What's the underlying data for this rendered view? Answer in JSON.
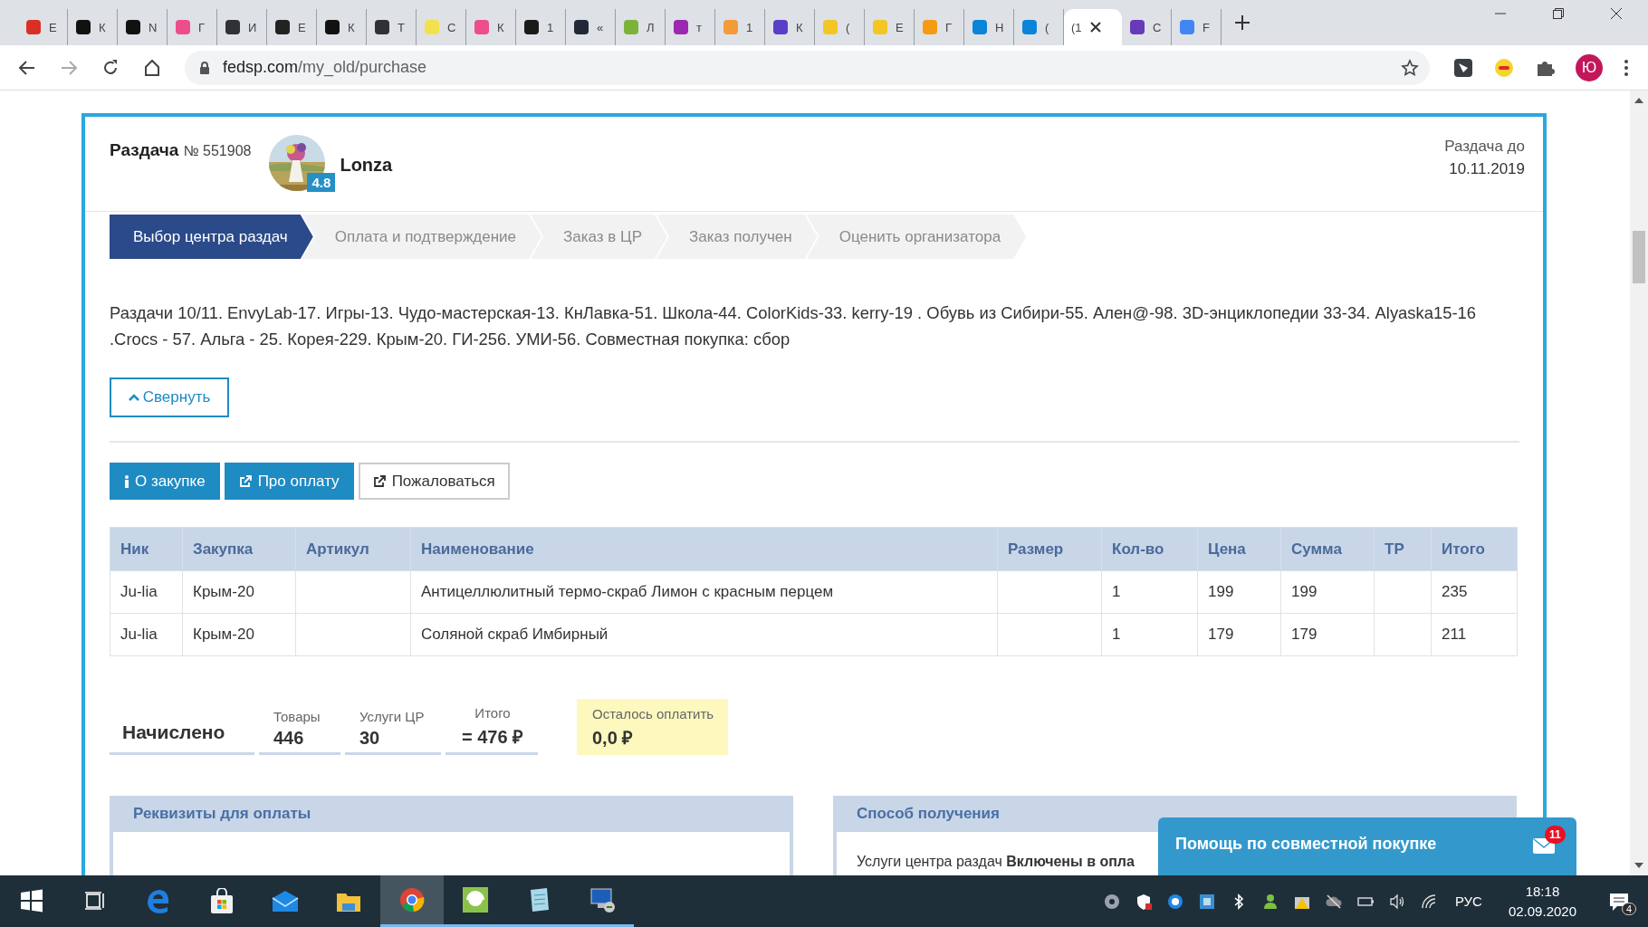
{
  "browser": {
    "tabs": [
      {
        "title": "Е",
        "color": "#d93025",
        "selected": false
      },
      {
        "title": "К",
        "color": "#111111",
        "selected": false
      },
      {
        "title": "N",
        "color": "#111111",
        "selected": false
      },
      {
        "title": "Г",
        "color": "#ee4d8b",
        "selected": false
      },
      {
        "title": "И",
        "color": "#2f3136",
        "selected": false
      },
      {
        "title": "Е",
        "color": "#222222",
        "selected": false
      },
      {
        "title": "К",
        "color": "#111111",
        "selected": false
      },
      {
        "title": "Т",
        "color": "#2f3136",
        "selected": false
      },
      {
        "title": "С",
        "color": "#f4e04d",
        "selected": false
      },
      {
        "title": "К",
        "color": "#ee4d8b",
        "selected": false
      },
      {
        "title": "1",
        "color": "#1a1a1a",
        "selected": false
      },
      {
        "title": "«",
        "color": "#222838",
        "selected": false
      },
      {
        "title": "Л",
        "color": "#7bb33a",
        "selected": false
      },
      {
        "title": "т",
        "color": "#9c27b0",
        "selected": false
      },
      {
        "title": "1",
        "color": "#f29c38",
        "selected": false
      },
      {
        "title": "К",
        "color": "#5a3ec8",
        "selected": false
      },
      {
        "title": "(",
        "color": "#f3c623",
        "selected": false
      },
      {
        "title": "Е",
        "color": "#f3c623",
        "selected": false
      },
      {
        "title": "Г",
        "color": "#f39c12",
        "selected": false
      },
      {
        "title": "Н",
        "color": "#0a84d8",
        "selected": false
      },
      {
        "title": "(",
        "color": "#0a84d8",
        "selected": false
      },
      {
        "title": "(1",
        "selected": true
      },
      {
        "title": "С",
        "color": "#673ab7",
        "selected": false
      },
      {
        "title": "F",
        "color": "#4285f4",
        "selected": false
      }
    ],
    "address": {
      "host": "fedsp.com",
      "path": "/my_old/purchase"
    },
    "profile_initial": "Ю"
  },
  "page": {
    "header": {
      "title": "Раздача",
      "number": "№ 551908",
      "organizer": "Lonza",
      "rating": "4.8",
      "deadline_label": "Раздача до",
      "deadline": "10.11.2019"
    },
    "steps": [
      {
        "label": "Выбор центра раздач",
        "selected": true
      },
      {
        "label": "Оплата и подтверждение",
        "selected": false
      },
      {
        "label": "Заказ в ЦР",
        "selected": false
      },
      {
        "label": "Заказ получен",
        "selected": false
      },
      {
        "label": "Оценить организатора",
        "selected": false
      }
    ],
    "description": "Раздачи 10/11. EnvyLab-17. Игры-13. Чудо-мастерская-13. КнЛавка-51. Школа-44. ColorKids-33. kerry-19 . Обувь из Сибири-55. Ален@-98. 3D-энциклопедии 33-34. Alyaska15-16 .Crocs - 57. Альга - 25. Корея-229. Крым-20. ГИ-256. УМИ-56. Совместная покупка: сбор",
    "collapse_button": "Свернуть",
    "action_buttons": [
      {
        "label": "О закупке",
        "kind": "info",
        "primary": true
      },
      {
        "label": "Про оплату",
        "kind": "link",
        "primary": true
      },
      {
        "label": "Пожаловаться",
        "kind": "link",
        "primary": false
      }
    ],
    "table": {
      "columns": [
        "Ник",
        "Закупка",
        "Артикул",
        "Наименование",
        "Размер",
        "Кол-во",
        "Цена",
        "Сумма",
        "ТР",
        "Итого"
      ],
      "rows": [
        [
          "Ju-lia",
          "Крым-20",
          null,
          "Антицеллюлитный термо-скраб Лимон с красным перцем",
          null,
          "1",
          "199",
          "199",
          null,
          "235"
        ],
        [
          "Ju-lia",
          "Крым-20",
          null,
          "Соляной скраб Имбирный",
          null,
          "1",
          "179",
          "179",
          null,
          "211"
        ]
      ]
    },
    "summary": {
      "title": "Начислено",
      "items": [
        {
          "label": "Товары",
          "value": "446"
        },
        {
          "label": "Услуги ЦР",
          "value": "30"
        },
        {
          "label": "Итого",
          "value": "= 476 ₽"
        }
      ],
      "remaining": {
        "label": "Осталось оплатить",
        "value": "0,0 ₽"
      }
    },
    "panels": [
      {
        "title": "Реквизиты для оплаты"
      },
      {
        "title": "Способ получения",
        "text": "Услуги центра раздач **Включены в опла**"
      }
    ],
    "chat": {
      "title": "Помощь по совместной покупке",
      "badge": "11"
    }
  },
  "taskbar": {
    "apps": [
      {
        "kind": "start",
        "running": false,
        "selected": false
      },
      {
        "kind": "taskview",
        "running": false,
        "selected": false
      },
      {
        "kind": "edge",
        "running": false,
        "selected": false
      },
      {
        "kind": "store",
        "running": false,
        "selected": false
      },
      {
        "kind": "mail",
        "running": false,
        "selected": false
      },
      {
        "kind": "folder",
        "running": false,
        "selected": false
      },
      {
        "kind": "chrome",
        "running": true,
        "selected": true
      },
      {
        "kind": "headset",
        "running": true,
        "selected": false
      },
      {
        "kind": "notepad",
        "running": true,
        "selected": false
      },
      {
        "kind": "remote",
        "running": true,
        "selected": false
      }
    ],
    "tray": [
      {
        "kind": "skype"
      },
      {
        "kind": "shield"
      },
      {
        "kind": "phone"
      },
      {
        "kind": "chip"
      },
      {
        "kind": "bluetooth"
      },
      {
        "kind": "person"
      },
      {
        "kind": "warning"
      },
      {
        "kind": "cloud"
      },
      {
        "kind": "battery"
      },
      {
        "kind": "volume"
      },
      {
        "kind": "wifi"
      }
    ],
    "language": "РУС",
    "time": "18:18",
    "date": "02.09.2020",
    "notifications": "4"
  }
}
